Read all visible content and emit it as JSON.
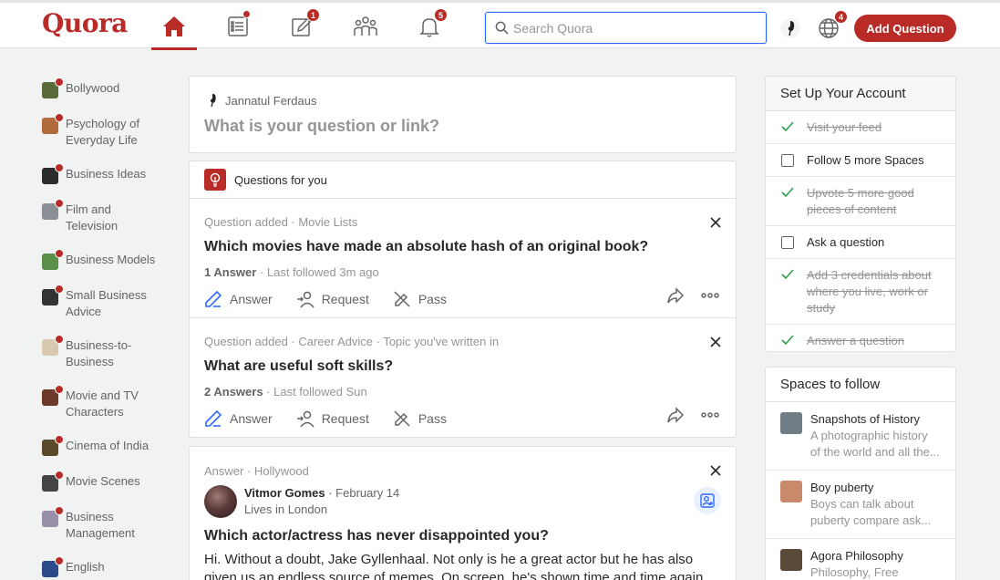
{
  "header": {
    "logo": "Quora",
    "notifications": {
      "answer": "1",
      "spaces": "",
      "bell": "5",
      "languages": "4"
    },
    "search": {
      "placeholder": "Search Quora",
      "value": ""
    },
    "add_question": "Add Question"
  },
  "sidebar": {
    "items": [
      {
        "label": "Bollywood",
        "color": "#5a6b3a"
      },
      {
        "label": "Psychology of Everyday Life",
        "color": "#b06a3c"
      },
      {
        "label": "Business Ideas",
        "color": "#2c2c2c"
      },
      {
        "label": "Film and Television",
        "color": "#8a8f96"
      },
      {
        "label": "Business Models",
        "color": "#5a8f4a"
      },
      {
        "label": "Small Business Advice",
        "color": "#333333"
      },
      {
        "label": "Business-to-Business",
        "color": "#d8c9b0"
      },
      {
        "label": "Movie and TV Characters",
        "color": "#6b3a2a"
      },
      {
        "label": "Cinema of India",
        "color": "#5b4a2a"
      },
      {
        "label": "Movie Scenes",
        "color": "#444444"
      },
      {
        "label": "Business Management",
        "color": "#9a8fa8"
      },
      {
        "label": "English",
        "color": "#2a4a8a"
      }
    ]
  },
  "ask": {
    "user": "Jannatul Ferdaus",
    "prompt": "What is your question or link?"
  },
  "questions_for_you": {
    "title": "Questions for you",
    "items": [
      {
        "meta": "Question added · Movie Lists",
        "title": "Which movies have made an absolute hash of an original book?",
        "answers": "1 Answer",
        "followed": " · Last followed 3m ago"
      },
      {
        "meta": "Question added · Career Advice · Topic you've written in",
        "title": "What are useful soft skills?",
        "answers": "2 Answers",
        "followed": " · Last followed Sun"
      }
    ],
    "actions": {
      "answer": "Answer",
      "request": "Request",
      "pass": "Pass"
    }
  },
  "answer_card": {
    "meta": "Answer · Hollywood",
    "author": "Vitmor Gomes",
    "date": " · February 14",
    "credential": "Lives in London",
    "title": "Which actor/actress has never disappointed you?",
    "body": "Hi. Without a doubt, Jake Gyllenhaal. Not only is he a great actor but he has also given us an endless source of memes. On screen, he's shown time and time again that"
  },
  "setup": {
    "title": "Set Up Your Account",
    "items": [
      {
        "label": "Visit your feed",
        "done": true
      },
      {
        "label": "Follow 5 more Spaces",
        "done": false
      },
      {
        "label": "Upvote 5 more good pieces of content",
        "done": true
      },
      {
        "label": "Ask a question",
        "done": false
      },
      {
        "label": "Add 3 credentials about where you live, work or study",
        "done": true
      },
      {
        "label": "Answer a question",
        "done": true
      }
    ]
  },
  "spaces": {
    "title": "Spaces to follow",
    "items": [
      {
        "name": "Snapshots of History",
        "desc": "A photographic history of the world and all the...",
        "color": "#6f7b85"
      },
      {
        "name": "Boy puberty",
        "desc": "Boys can talk about puberty compare ask...",
        "color": "#c98a6c"
      },
      {
        "name": "Agora Philosophy",
        "desc": "Philosophy, Free",
        "color": "#5a4a3a"
      }
    ]
  },
  "colors": {
    "brand": "#b92b27",
    "link": "#2e69ff"
  }
}
